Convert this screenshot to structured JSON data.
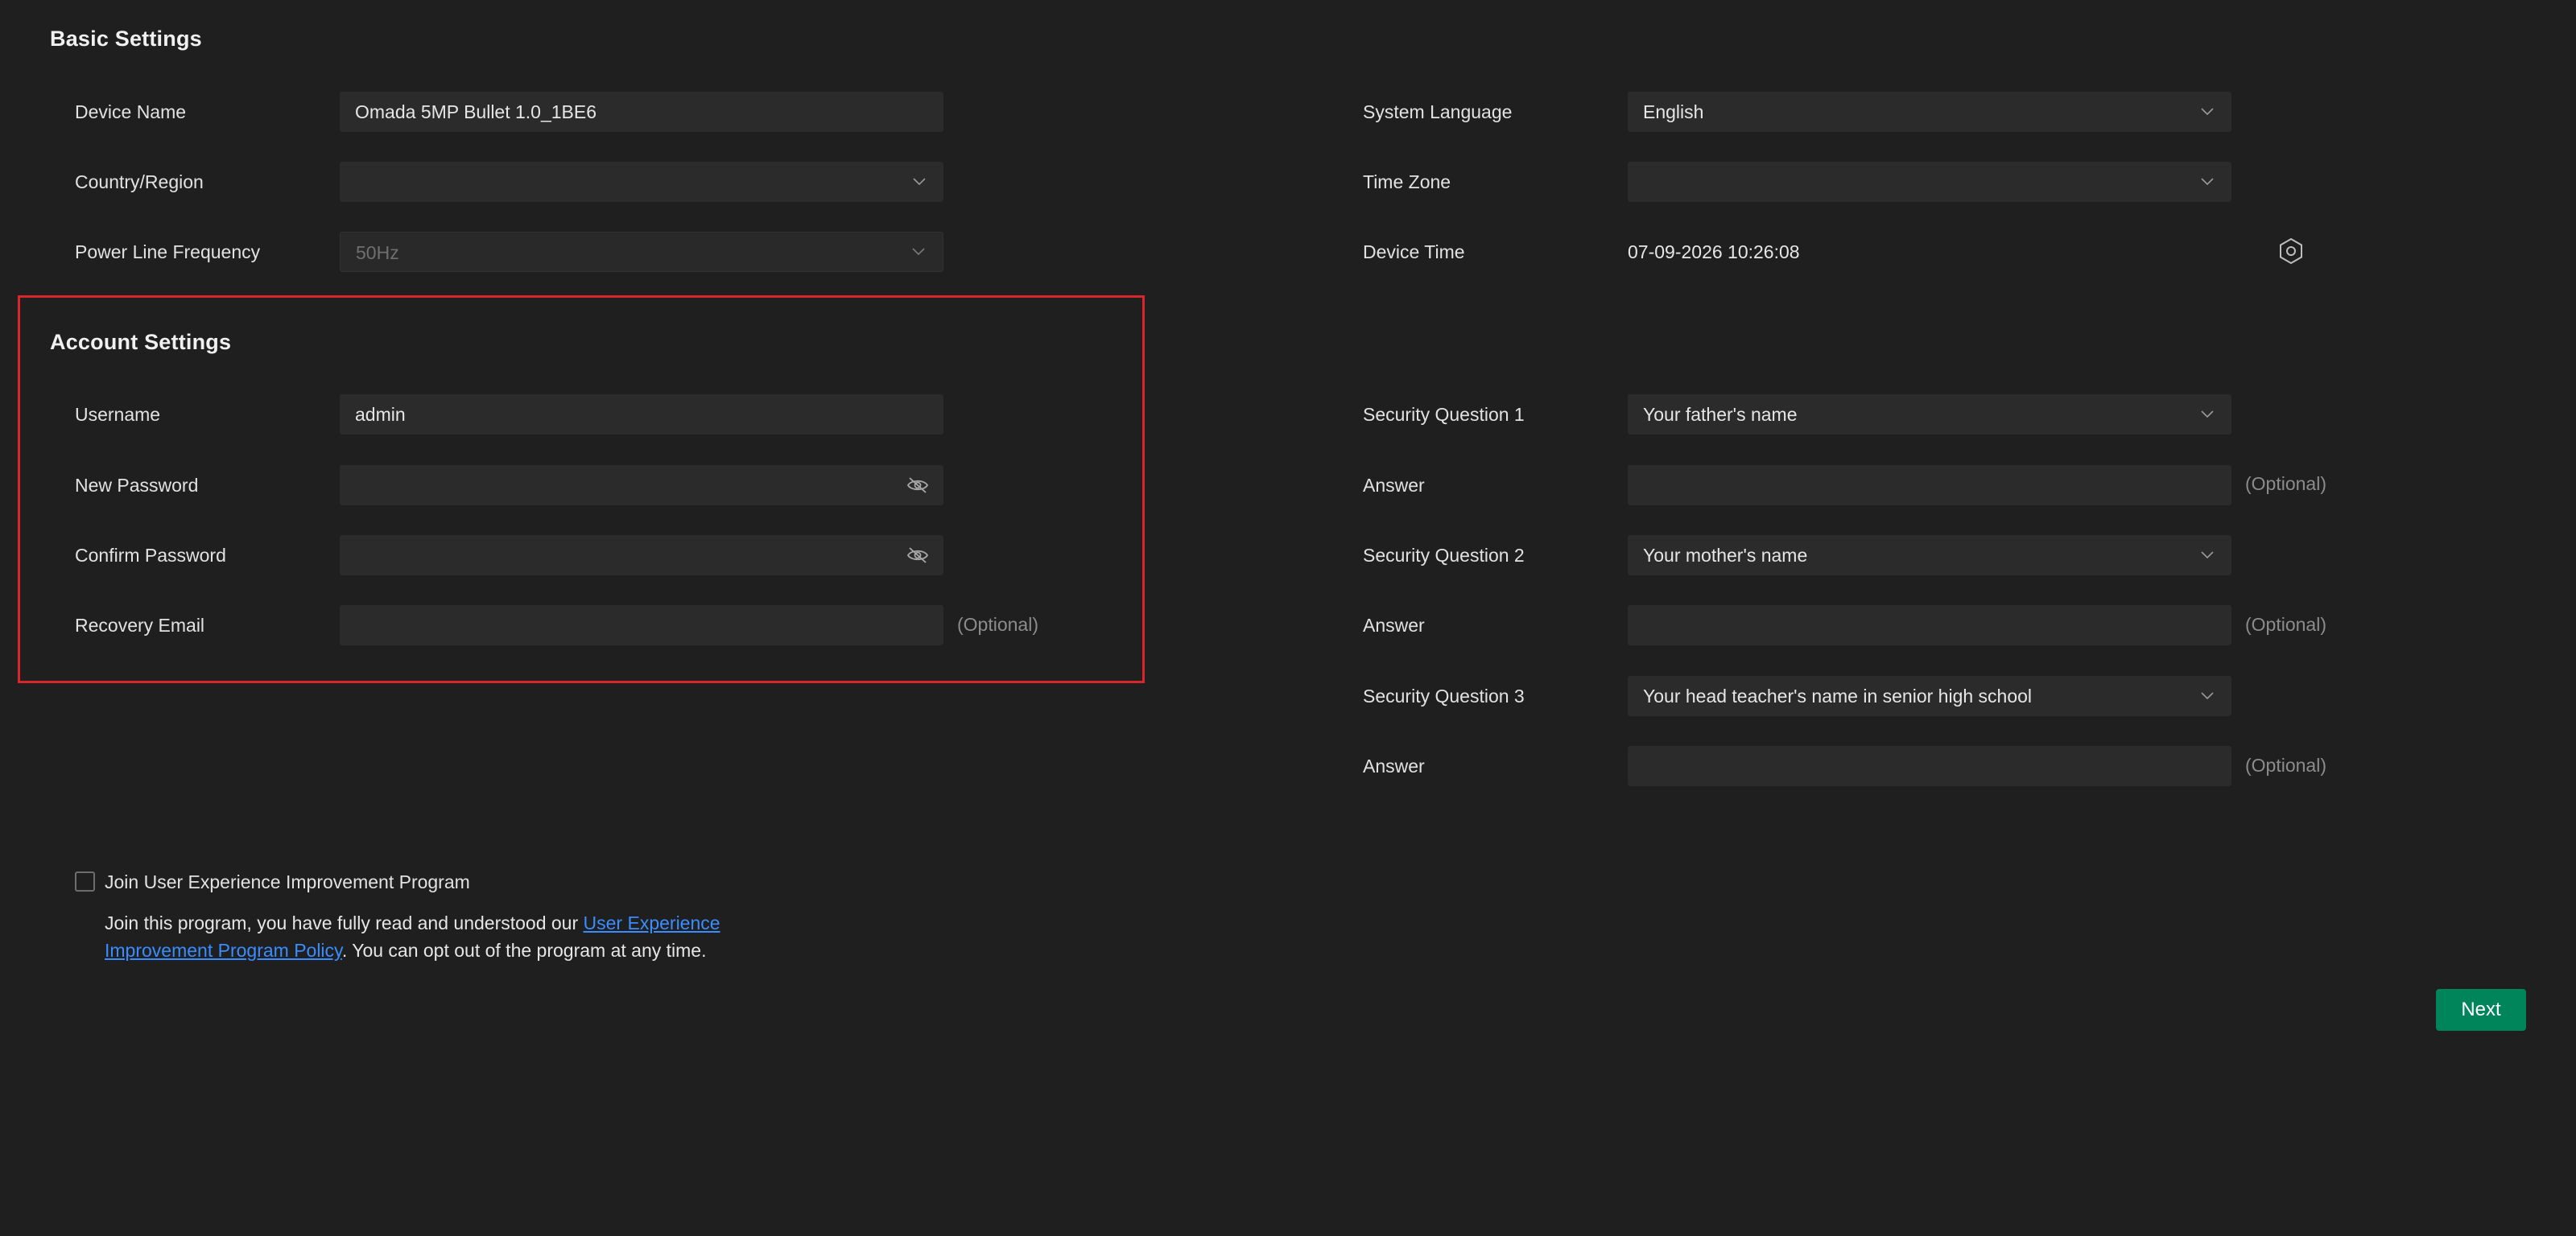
{
  "basic_settings": {
    "title": "Basic Settings",
    "device_name": {
      "label": "Device Name",
      "value": "Omada 5MP Bullet 1.0_1BE6"
    },
    "country_region": {
      "label": "Country/Region",
      "value": ""
    },
    "power_line_frequency": {
      "label": "Power Line Frequency",
      "value": "50Hz"
    },
    "system_language": {
      "label": "System Language",
      "value": "English"
    },
    "time_zone": {
      "label": "Time Zone",
      "value": ""
    },
    "device_time": {
      "label": "Device Time",
      "value": "07-09-2026 10:26:08"
    }
  },
  "account_settings": {
    "title": "Account Settings",
    "username": {
      "label": "Username",
      "value": "admin"
    },
    "new_password": {
      "label": "New Password",
      "value": ""
    },
    "confirm_password": {
      "label": "Confirm Password",
      "value": ""
    },
    "recovery_email": {
      "label": "Recovery Email",
      "value": "",
      "optional": "(Optional)"
    }
  },
  "security": {
    "q1": {
      "label": "Security Question 1",
      "value": "Your father's name"
    },
    "a1": {
      "label": "Answer",
      "value": "",
      "optional": "(Optional)"
    },
    "q2": {
      "label": "Security Question 2",
      "value": "Your mother's name"
    },
    "a2": {
      "label": "Answer",
      "value": "",
      "optional": "(Optional)"
    },
    "q3": {
      "label": "Security Question 3",
      "value": "Your head teacher's name in senior high school"
    },
    "a3": {
      "label": "Answer",
      "value": "",
      "optional": "(Optional)"
    }
  },
  "program": {
    "checkbox_label": "Join User Experience Improvement Program",
    "checked": false,
    "desc_prefix": "Join this program, you have fully read and understood our ",
    "link_text": "User Experience Improvement Program Policy",
    "desc_suffix": ". You can opt out of the program at any time."
  },
  "actions": {
    "next_label": "Next"
  },
  "colors": {
    "background": "#1f1f1f",
    "field": "#2b2b2b",
    "accent_green": "#00855a",
    "link_blue": "#3a8dff",
    "highlight_red": "#d8262c"
  },
  "icons": {
    "dropdown": "chevron-down-icon",
    "password_toggle": "eye-off-icon",
    "time_sync": "sync-settings-icon"
  }
}
